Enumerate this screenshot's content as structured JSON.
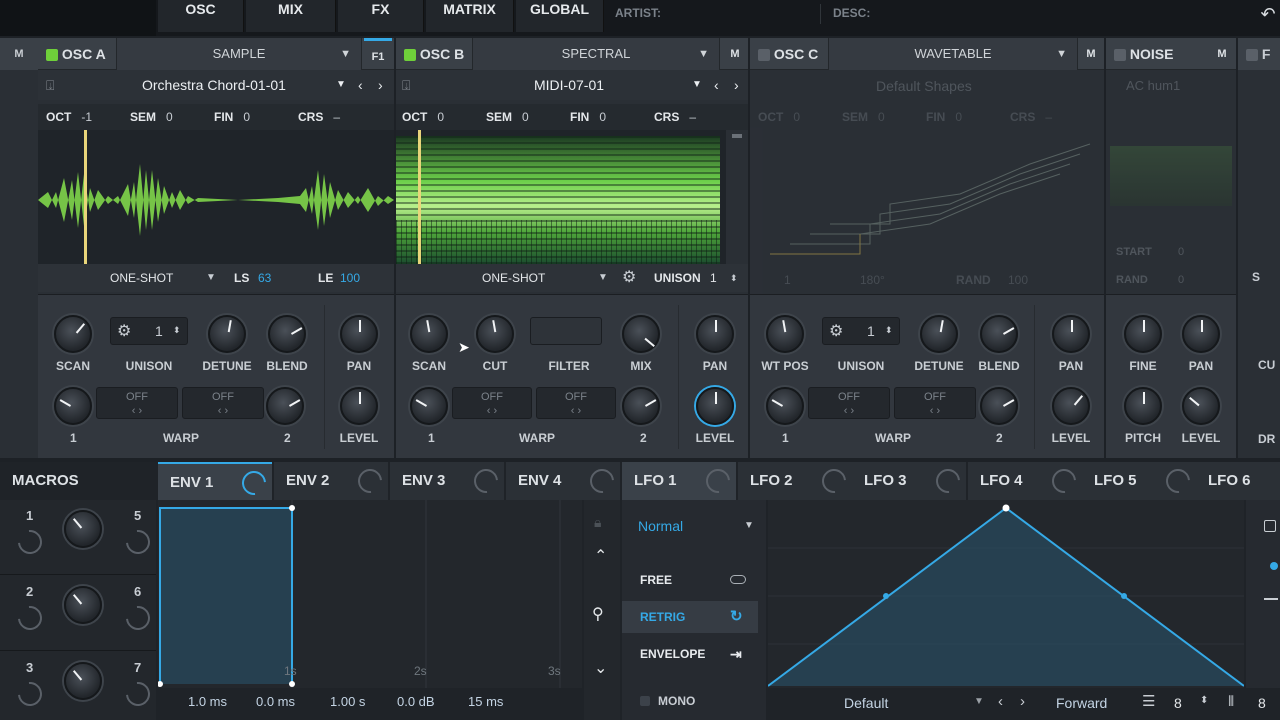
{
  "topbar": {
    "tabs": [
      "OSC",
      "MIX",
      "FX",
      "MATRIX",
      "GLOBAL"
    ],
    "artist_label": "ARTIST:",
    "desc_label": "DESC:"
  },
  "osc_a": {
    "title": "OSC A",
    "mode": "SAMPLE",
    "fx_badge": "F1",
    "mute": "M",
    "sample": "Orchestra Chord-01-01",
    "oct_label": "OCT",
    "oct": "-1",
    "sem_label": "SEM",
    "sem": "0",
    "fin_label": "FIN",
    "fin": "0",
    "crs_label": "CRS",
    "crs": "–",
    "playmode": "ONE-SHOT",
    "ls_label": "LS",
    "ls": "63",
    "le_label": "LE",
    "le": "100",
    "knobs": {
      "scan": "SCAN",
      "unison": "UNISON",
      "unison_val": "1",
      "detune": "DETUNE",
      "blend": "BLEND",
      "pan": "PAN",
      "warp": "WARP",
      "warp1": "1",
      "warp2": "2",
      "level": "LEVEL",
      "off1": "OFF",
      "off2": "OFF"
    }
  },
  "osc_b": {
    "title": "OSC B",
    "mode": "SPECTRAL",
    "mute": "M",
    "sample": "MIDI-07-01",
    "oct_label": "OCT",
    "oct": "0",
    "sem_label": "SEM",
    "sem": "0",
    "fin_label": "FIN",
    "fin": "0",
    "crs_label": "CRS",
    "crs": "–",
    "playmode": "ONE-SHOT",
    "unison_label": "UNISON",
    "unison": "1",
    "knobs": {
      "scan": "SCAN",
      "cut": "CUT",
      "filter": "FILTER",
      "mix": "MIX",
      "pan": "PAN",
      "warp": "WARP",
      "warp1": "1",
      "warp2": "2",
      "level": "LEVEL",
      "off1": "OFF",
      "off2": "OFF"
    }
  },
  "osc_c": {
    "title": "OSC C",
    "mode": "WAVETABLE",
    "mute": "M",
    "sample": "Default Shapes",
    "oct_label": "OCT",
    "oct": "0",
    "sem_label": "SEM",
    "sem": "0",
    "fin_label": "FIN",
    "fin": "0",
    "crs_label": "CRS",
    "crs": "–",
    "phase": "180°",
    "rand_label": "RAND",
    "rand": "100",
    "row5_num": "1",
    "knobs": {
      "wtpos": "WT POS",
      "unison": "UNISON",
      "unison_val": "1",
      "detune": "DETUNE",
      "blend": "BLEND",
      "pan": "PAN",
      "warp": "WARP",
      "warp1": "1",
      "warp2": "2",
      "level": "LEVEL",
      "off1": "OFF",
      "off2": "OFF"
    }
  },
  "noise": {
    "title": "NOISE",
    "mute": "M",
    "sample": "AC hum1",
    "start_label": "START",
    "start": "0",
    "rand_label": "RAND",
    "rand": "0",
    "fine": "FINE",
    "pan": "PAN",
    "pitch": "PITCH",
    "level": "LEVEL"
  },
  "edge": {
    "filter_label": "F",
    "solo": "S",
    "cu": "CU",
    "dr": "DR"
  },
  "bottom": {
    "macros": "MACROS",
    "tabs": [
      "ENV 1",
      "ENV 2",
      "ENV 3",
      "ENV 4",
      "LFO 1",
      "LFO 2",
      "LFO 3",
      "LFO 4",
      "LFO 5",
      "LFO 6"
    ],
    "macro_nums": [
      "1",
      "5",
      "2",
      "6",
      "3",
      "7"
    ],
    "env_markers": [
      "1s",
      "2s",
      "3s"
    ],
    "env_values": [
      "1.0 ms",
      "0.0 ms",
      "1.00 s",
      "0.0 dB",
      "15 ms"
    ],
    "lfo_mode": "Normal",
    "free": "FREE",
    "retrig": "RETRIG",
    "envelope": "ENVELOPE",
    "mono": "MONO",
    "lfo_shape": "Default",
    "direction": "Forward",
    "grid1": "8",
    "grid2": "8"
  },
  "colors": {
    "accent": "#35a9e6",
    "osc_led": "#6fd03a",
    "wave_green": "#7fd64a"
  }
}
